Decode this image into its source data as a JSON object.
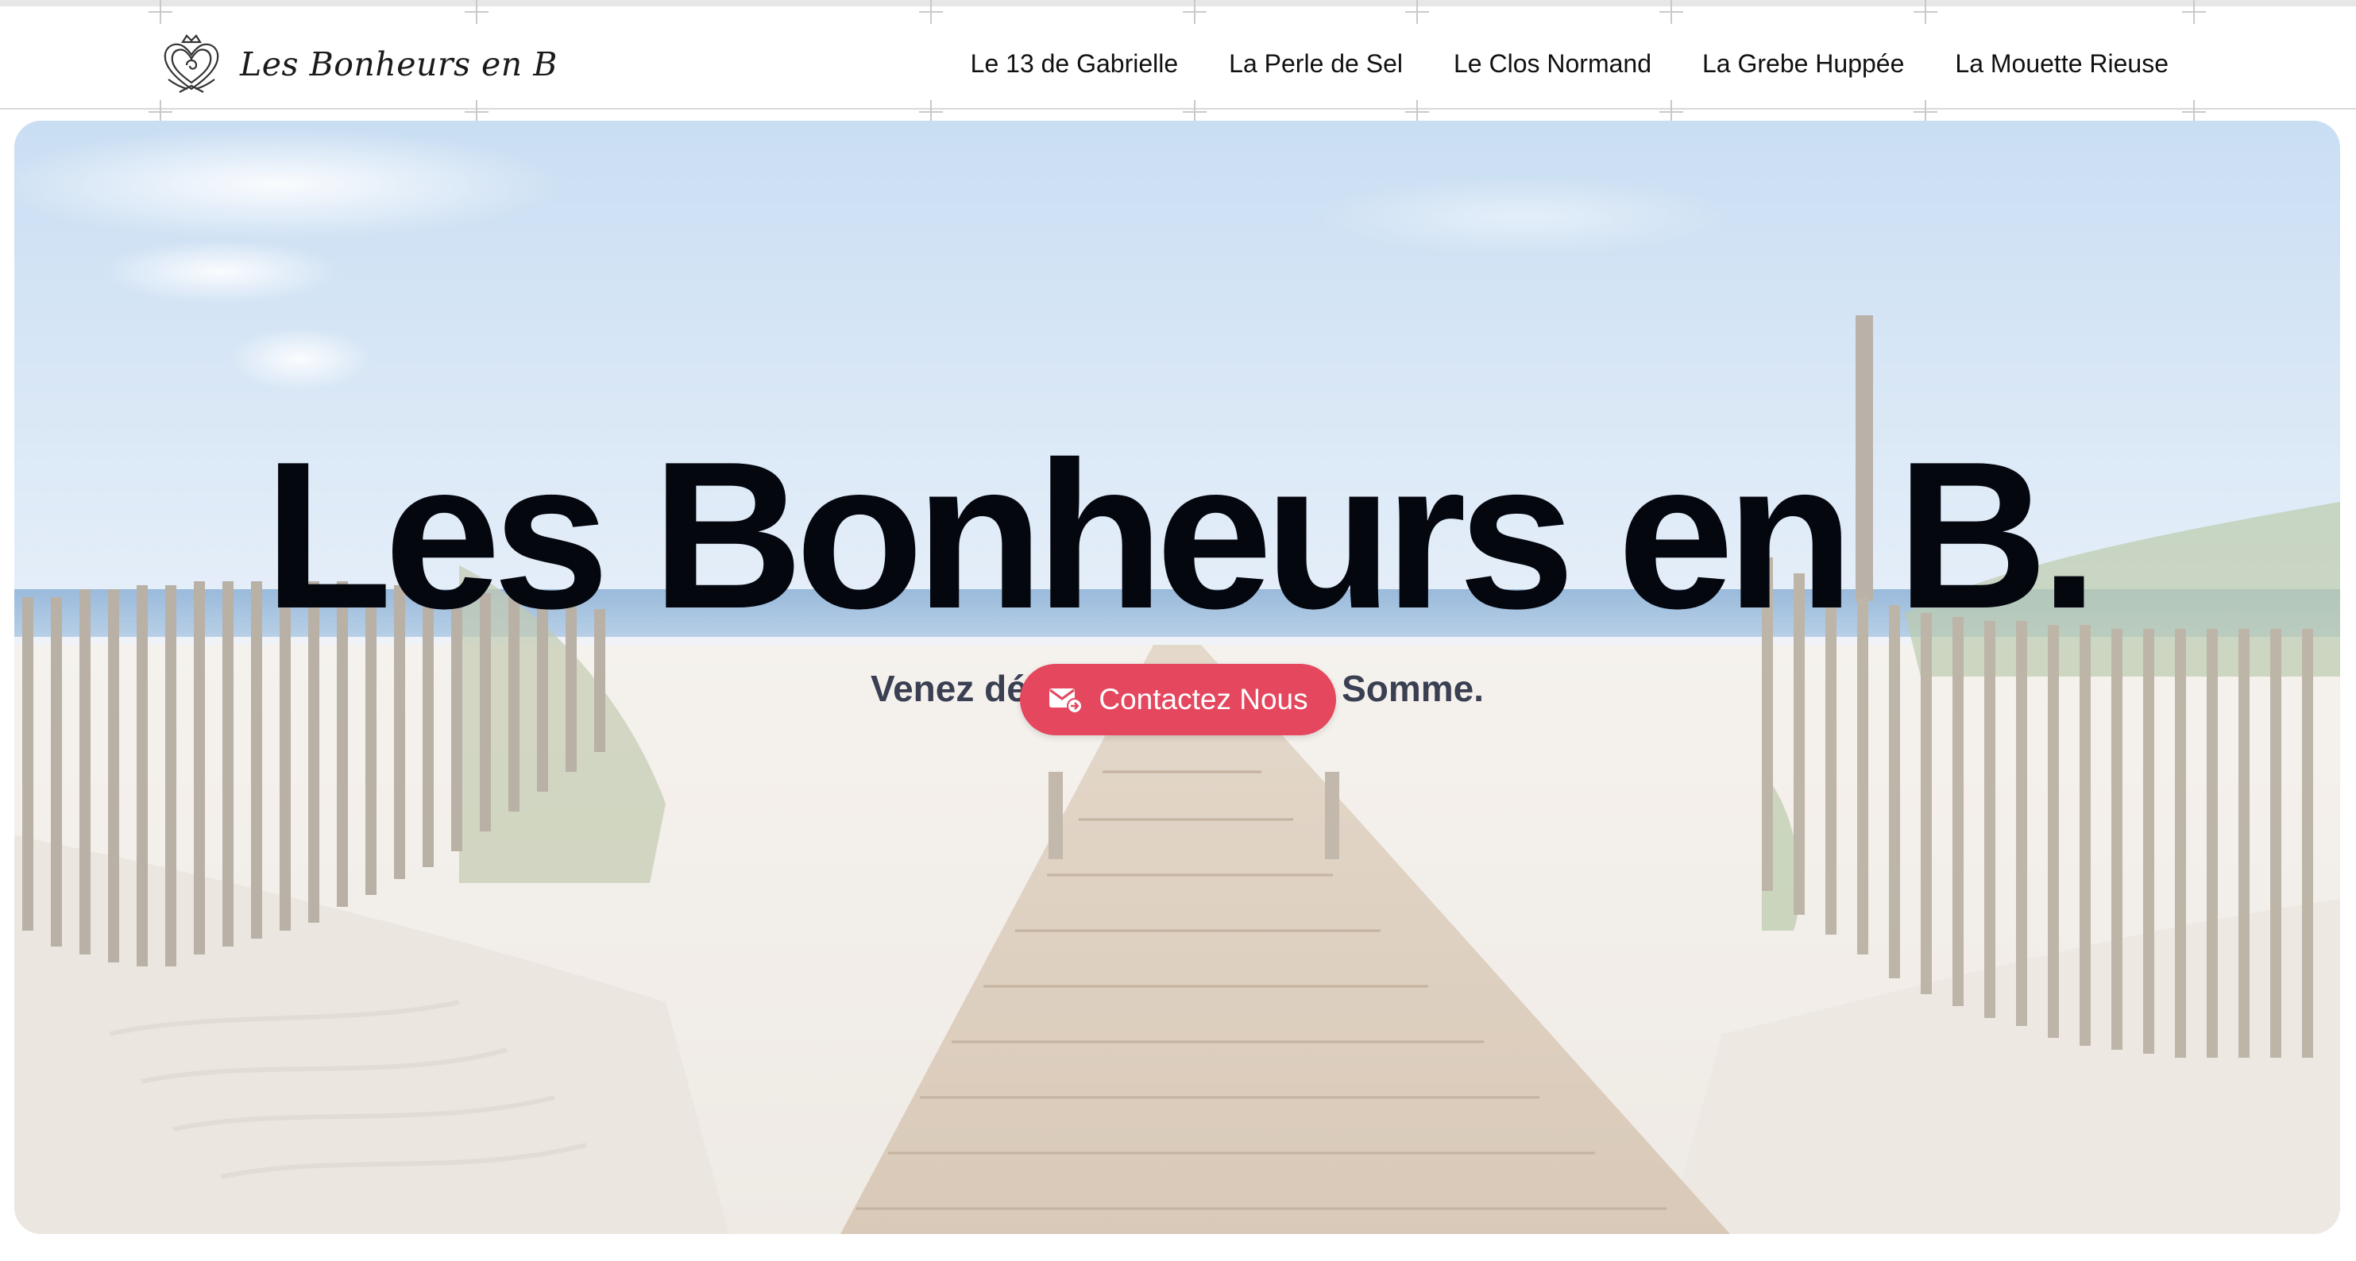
{
  "brand": {
    "name": "Les Bonheurs en B",
    "logo_icon": "heart-emblem-icon"
  },
  "nav": {
    "items": [
      {
        "label": "Le 13 de Gabrielle"
      },
      {
        "label": "La Perle de Sel"
      },
      {
        "label": "Le Clos Normand"
      },
      {
        "label": "La Grebe Huppée"
      },
      {
        "label": "La Mouette Rieuse"
      }
    ]
  },
  "hero": {
    "title": "Les Bonheurs en B.",
    "subtitle": "Venez découvrir la Baie de Somme.",
    "cta_label": "Contactez Nous",
    "cta_icon": "mail-send-icon",
    "background": "beach-boardwalk-photo"
  },
  "colors": {
    "accent": "#e4475e",
    "title_text": "#05070f",
    "subtitle_text": "#3a3f52",
    "nav_text": "#111111"
  }
}
